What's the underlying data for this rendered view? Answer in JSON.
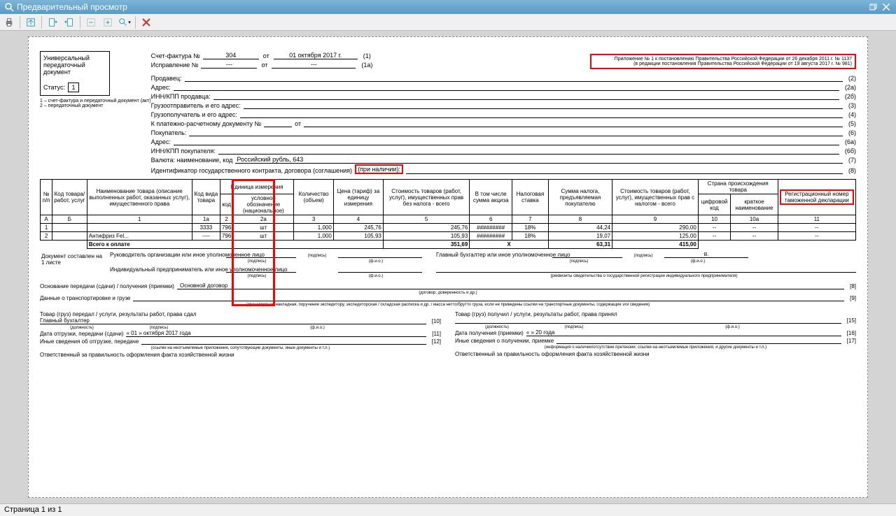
{
  "window": {
    "title": "Предварительный просмотр"
  },
  "statusbar": "Страница 1 из 1",
  "annex": {
    "line1": "Приложение № 1 к постановлению Правительства Российской Федерации от 26 декабря 2011 г. № 1137",
    "line2": "(в редакции постановления Правительства Российской Федерации от 19 августа 2017 г. № 981)"
  },
  "header": {
    "upd_label": "Универсальный передаточный документ",
    "status_label": "Статус:",
    "status_value": "1",
    "status_note1": "1 – счет-фактура и передаточный документ (акт)",
    "status_note2": "2 – передаточный документ",
    "sf_label": "Счет-фактура №",
    "sf_no": "304",
    "sf_ot": "от",
    "sf_date": "01 октября 2017 г.",
    "sf_n": "(1)",
    "isp_label": "Исправление №",
    "isp_no": "---",
    "isp_ot": "от",
    "isp_date": "---",
    "isp_n": "(1а)",
    "seller_label": "Продавец:",
    "seller_n": "(2)",
    "addr_label": "Адрес:",
    "addr_n": "(2а)",
    "inn_label": "ИНН/КПП продавца:",
    "inn_n": "(2б)",
    "cons_label": "Грузоотправитель и его адрес:",
    "cons_n": "(3)",
    "consignee_label": "Грузополучатель и его адрес:",
    "consignee_n": "(4)",
    "paydoc_label": "К платежно-расчетному документу №",
    "paydoc_ot": "от",
    "paydoc_n": "(5)",
    "buyer_label": "Покупатель:",
    "buyer_n": "(6)",
    "baddr_label": "Адрес:",
    "baddr_n": "(6а)",
    "binn_label": "ИНН/КПП покупателя:",
    "binn_n": "(6б)",
    "cur_label": "Валюта: наименование, код",
    "cur_val": "Российский рубль, 643",
    "cur_n": "(7)",
    "ident_label": "Идентификатор государственного контракта, договора (соглашения)",
    "ident_pri": "(при наличии):",
    "ident_n": "(8)"
  },
  "table": {
    "headers": {
      "no": "№ п/п",
      "code": "Код товара/ работ, услуг",
      "name": "Наименование товара (описание выполненных работ, оказанных услуг), имущественного права",
      "kind": "Код вида товара",
      "unit": "Единица измерения",
      "unit_code": "код",
      "unit_name": "условное обозначение (национальное)",
      "qty": "Количество (объем)",
      "price": "Цена (тариф) за единицу измерения",
      "cost_notax": "Стоимость товаров (работ, услуг), имущественных прав без налога - всего",
      "excise": "В том числе сумма акциза",
      "rate": "Налоговая ставка",
      "tax": "Сумма налога, предъявляемая покупателю",
      "cost_tax": "Стоимость товаров (работ, услуг), имущественных прав с налогом - всего",
      "country": "Страна происхождения товара",
      "country_code": "цифровой код",
      "country_name": "краткое наименование",
      "reg": "Регистрационный номер таможенной декларации"
    },
    "numrow": {
      "a": "А",
      "b": "Б",
      "c1": "1",
      "c1a": "1а",
      "c2": "2",
      "c2a": "2а",
      "c3": "3",
      "c4": "4",
      "c5": "5",
      "c6": "6",
      "c7": "7",
      "c8": "8",
      "c9": "9",
      "c10": "10",
      "c10a": "10а",
      "c11": "11"
    },
    "rows": [
      {
        "no": "1",
        "code": "",
        "name": "",
        "kind": "3333",
        "ucode": "796",
        "uname": "шт",
        "qty": "1,000",
        "price": "245,76",
        "cost": "245,76",
        "excise": "#########",
        "rate": "18%",
        "tax": "44,24",
        "costt": "290,00",
        "cc": "--",
        "cn": "--",
        "gtd": "--"
      },
      {
        "no": "2",
        "code": "",
        "name": "Антифриз Fel...",
        "kind": "----",
        "ucode": "796",
        "uname": "шт",
        "qty": "1,000",
        "price": "105,93",
        "cost": "105,93",
        "excise": "#########",
        "rate": "18%",
        "tax": "19,07",
        "costt": "125,00",
        "cc": "--",
        "cn": "--",
        "gtd": "--"
      }
    ],
    "total_label": "Всего к оплате",
    "total_cost": "351,69",
    "total_x": "Х",
    "total_tax": "63,31",
    "total_costt": "415,00"
  },
  "signblock": {
    "doc_label": "Документ составлен на",
    "doc_sheets": "1 листе",
    "ruk": "Руководитель организации или иное уполномоченное лицо",
    "glb": "Главный бухгалтер или иное уполномоченное лицо",
    "ip": "Индивидуальный предприниматель или иное уполномоченное лицо",
    "sig": "(подпись)",
    "fio": "(ф.и.о.)",
    "rekv": "(реквизиты свидетельства о государственной регистрации индивидуального предпринимателя)",
    "v": "В."
  },
  "foot": {
    "osn_label": "Основание передачи (сдачи) / получения (приемки)",
    "osn_val": "Основной договор",
    "osn_n": "[8]",
    "osn_sub": "(договор; доверенность и др.)",
    "trans_label": "Данные о транспортировке и грузе",
    "trans_n": "[9]",
    "trans_sub": "(транспортная накладная, поручение экспедитору, экспедиторская / складская расписка и др. / масса нетто/брутто груза, если не приведены ссылки на транспортные документы, содержащие эти сведения)",
    "left": {
      "title": "Товар (груз) передал / услуги, результаты работ, права сдал",
      "pos": "Главный бухгалтер",
      "pos_n": "[10]",
      "dolzh": "(должность)",
      "date_label": "Дата отгрузки, передачи (сдачи)",
      "date_val": "« 01 »   октября   2017   года",
      "date_n": "[11]",
      "other_label": "Иные сведения об отгрузке, передаче",
      "other_n": "[12]",
      "other_sub": "(ссылки на неотъемлемые приложения, сопутствующие документы, иные документы и т.п.)",
      "resp": "Ответственный за правильность оформления факта хозяйственной жизни"
    },
    "right": {
      "title": "Товар (груз) получил / услуги, результаты работ, права принял",
      "pos_n": "[15]",
      "date_label": "Дата получения (приемки)",
      "date_val": "«      »                    20       года",
      "date_n": "[16]",
      "other_label": "Иные сведения о получении, приемке",
      "other_n": "[17]",
      "other_sub": "(информация о наличии/отсутствии претензии; ссылки на неотъемлемые приложения, и другие документы и т.п.)",
      "resp": "Ответственный за правильность оформления факта хозяйственной жизни"
    }
  }
}
